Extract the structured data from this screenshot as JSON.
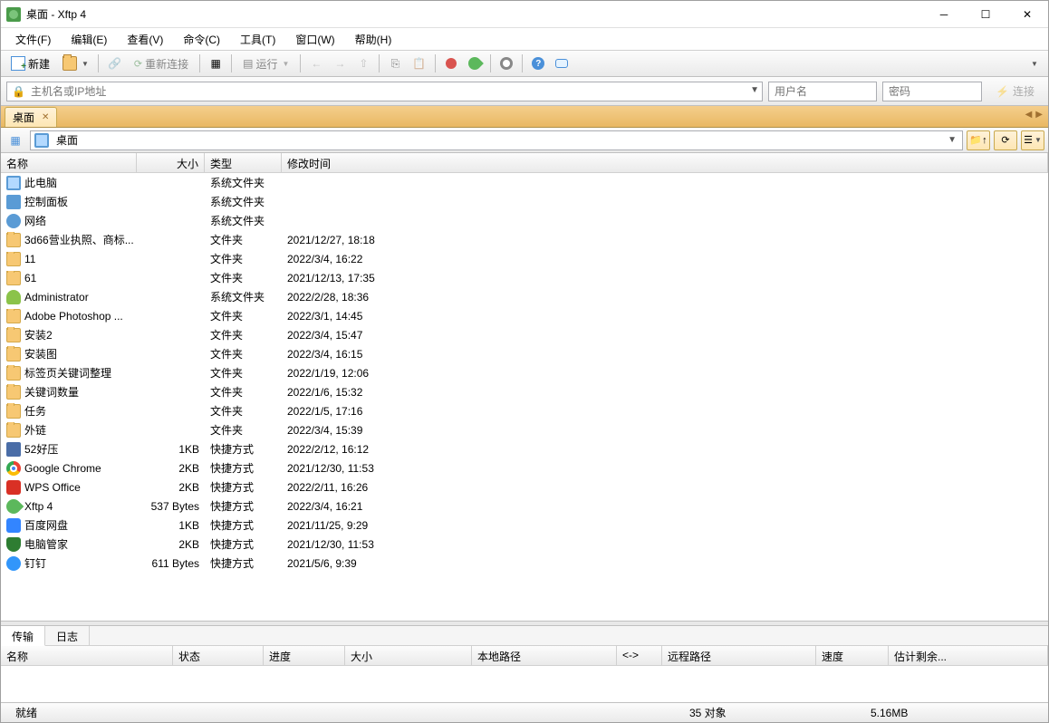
{
  "title": "桌面 - Xftp 4",
  "menu": {
    "file": "文件(F)",
    "edit": "编辑(E)",
    "view": "查看(V)",
    "cmd": "命令(C)",
    "tool": "工具(T)",
    "window": "窗口(W)",
    "help": "帮助(H)"
  },
  "toolbar": {
    "new": "新建",
    "reconnect": "重新连接",
    "run": "运行"
  },
  "connbar": {
    "host_placeholder": "主机名或IP地址",
    "user_placeholder": "用户名",
    "pass_placeholder": "密码",
    "connect": "连接"
  },
  "tab": {
    "label": "桌面"
  },
  "path": {
    "value": "桌面"
  },
  "columns": {
    "name": "名称",
    "size": "大小",
    "type": "类型",
    "modified": "修改时间"
  },
  "col_widths": {
    "name": 150,
    "size": 75,
    "type": 85,
    "modified": 830
  },
  "files": [
    {
      "icon": "fic-computer",
      "name": "此电脑",
      "size": "",
      "type": "系统文件夹",
      "modified": ""
    },
    {
      "icon": "fic-panel",
      "name": "控制面板",
      "size": "",
      "type": "系统文件夹",
      "modified": ""
    },
    {
      "icon": "fic-network",
      "name": "网络",
      "size": "",
      "type": "系统文件夹",
      "modified": ""
    },
    {
      "icon": "fic-folder",
      "name": "3d66营业执照、商标...",
      "size": "",
      "type": "文件夹",
      "modified": "2021/12/27, 18:18"
    },
    {
      "icon": "fic-folder",
      "name": "11",
      "size": "",
      "type": "文件夹",
      "modified": "2022/3/4, 16:22"
    },
    {
      "icon": "fic-folder",
      "name": "61",
      "size": "",
      "type": "文件夹",
      "modified": "2021/12/13, 17:35"
    },
    {
      "icon": "fic-user",
      "name": "Administrator",
      "size": "",
      "type": "系统文件夹",
      "modified": "2022/2/28, 18:36"
    },
    {
      "icon": "fic-folder",
      "name": "Adobe Photoshop ...",
      "size": "",
      "type": "文件夹",
      "modified": "2022/3/1, 14:45"
    },
    {
      "icon": "fic-folder",
      "name": "安装2",
      "size": "",
      "type": "文件夹",
      "modified": "2022/3/4, 15:47"
    },
    {
      "icon": "fic-folder",
      "name": "安装图",
      "size": "",
      "type": "文件夹",
      "modified": "2022/3/4, 16:15"
    },
    {
      "icon": "fic-folder",
      "name": "标签页关键词整理",
      "size": "",
      "type": "文件夹",
      "modified": "2022/1/19, 12:06"
    },
    {
      "icon": "fic-folder",
      "name": "关键词数量",
      "size": "",
      "type": "文件夹",
      "modified": "2022/1/6, 15:32"
    },
    {
      "icon": "fic-folder",
      "name": "任务",
      "size": "",
      "type": "文件夹",
      "modified": "2022/1/5, 17:16"
    },
    {
      "icon": "fic-folder",
      "name": "外链",
      "size": "",
      "type": "文件夹",
      "modified": "2022/3/4, 15:39"
    },
    {
      "icon": "fic-zip",
      "name": "52好压",
      "size": "1KB",
      "type": "快捷方式",
      "modified": "2022/2/12, 16:12"
    },
    {
      "icon": "fic-chrome",
      "name": "Google Chrome",
      "size": "2KB",
      "type": "快捷方式",
      "modified": "2021/12/30, 11:53"
    },
    {
      "icon": "fic-wps",
      "name": "WPS Office",
      "size": "2KB",
      "type": "快捷方式",
      "modified": "2022/2/11, 16:26"
    },
    {
      "icon": "fic-xftp",
      "name": "Xftp 4",
      "size": "537 Bytes",
      "type": "快捷方式",
      "modified": "2022/3/4, 16:21"
    },
    {
      "icon": "fic-baidu",
      "name": "百度网盘",
      "size": "1KB",
      "type": "快捷方式",
      "modified": "2021/11/25, 9:29"
    },
    {
      "icon": "fic-guard",
      "name": "电脑管家",
      "size": "2KB",
      "type": "快捷方式",
      "modified": "2021/12/30, 11:53"
    },
    {
      "icon": "fic-ding",
      "name": "钉钉",
      "size": "611 Bytes",
      "type": "快捷方式",
      "modified": "2021/5/6, 9:39"
    }
  ],
  "bottom_tabs": {
    "transfer": "传输",
    "log": "日志"
  },
  "transfer_cols": {
    "name": "名称",
    "status": "状态",
    "progress": "进度",
    "size": "大小",
    "local": "本地路径",
    "dir": "<->",
    "remote": "远程路径",
    "speed": "速度",
    "eta": "估计剩余..."
  },
  "status": {
    "ready": "就绪",
    "objects": "35 对象",
    "total": "5.16MB"
  }
}
